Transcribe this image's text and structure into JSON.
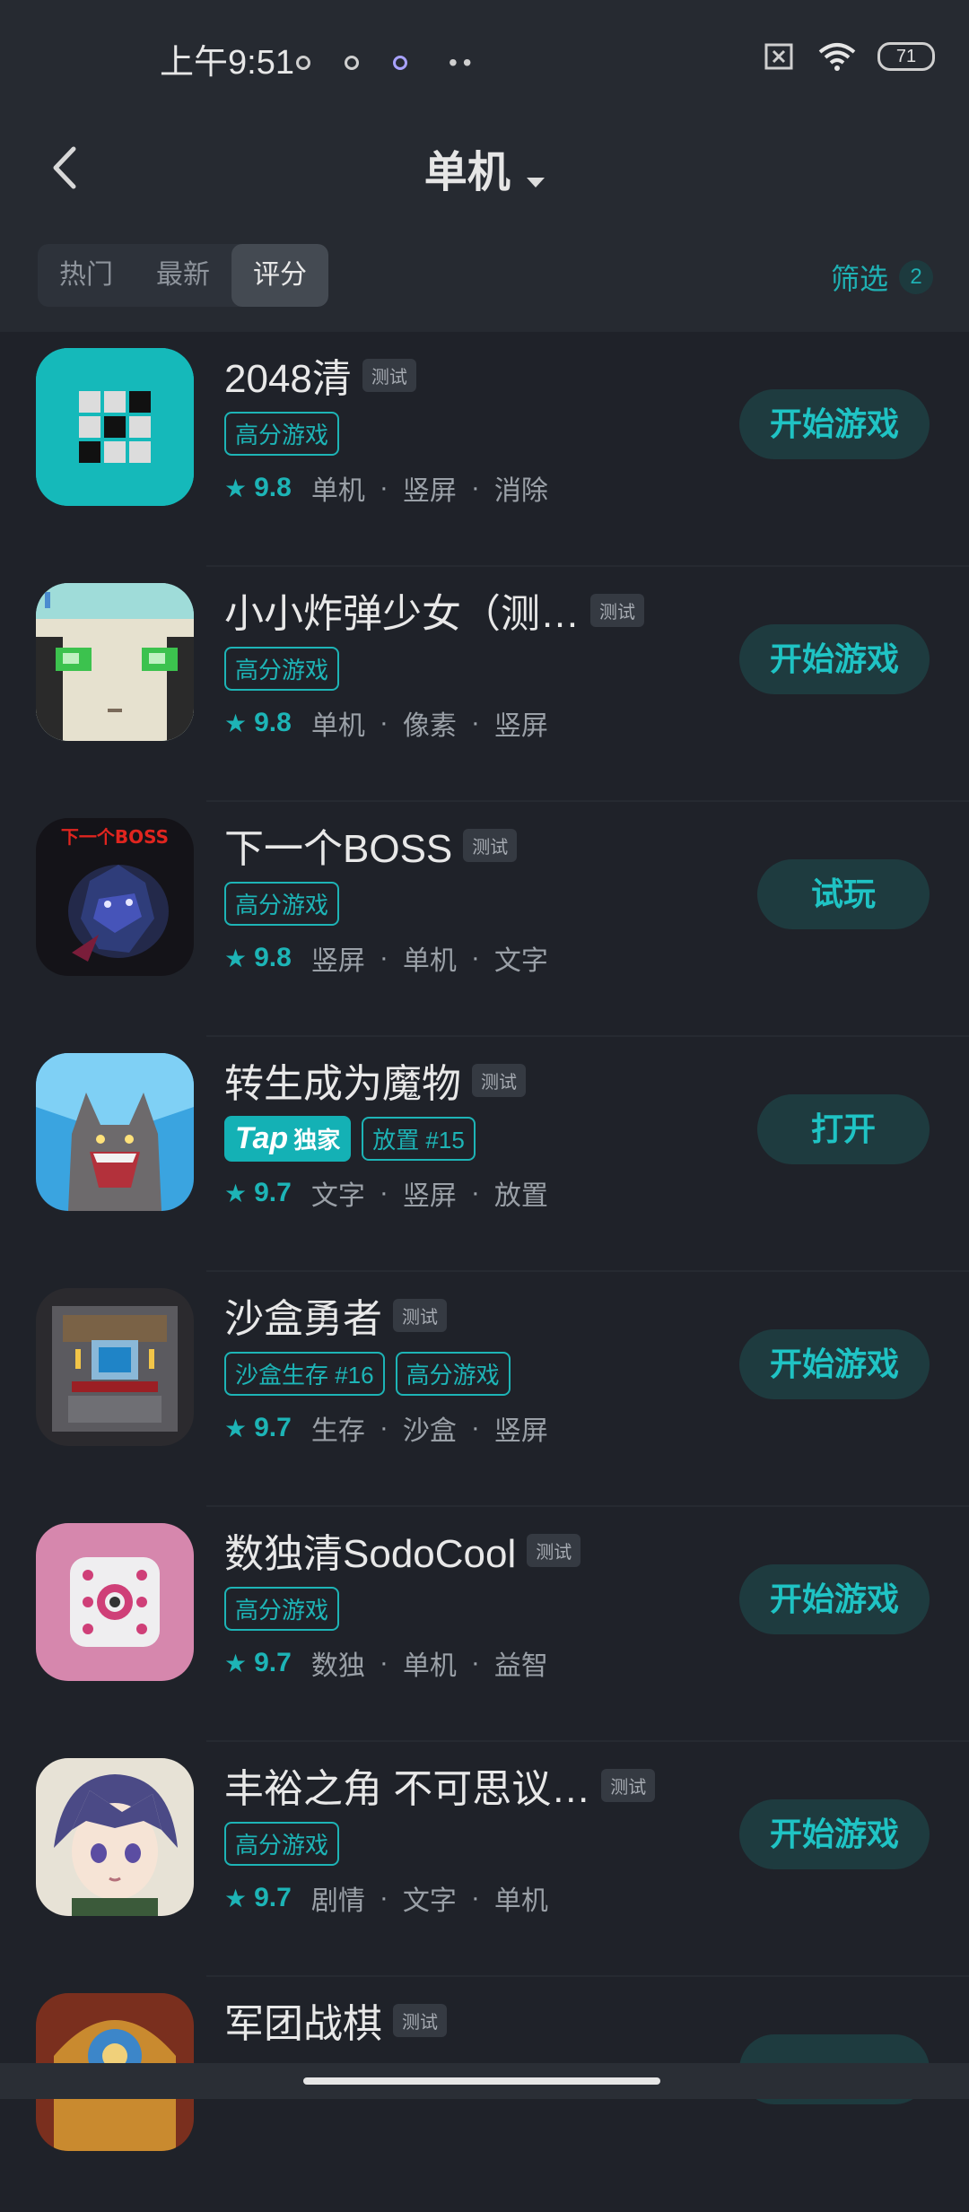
{
  "status_bar": {
    "time": "上午9:51",
    "battery": "71"
  },
  "header": {
    "title": "单机",
    "tabs": [
      "热门",
      "最新",
      "评分"
    ],
    "active_tab": "评分",
    "filter_label": "筛选",
    "filter_count": "2"
  },
  "test_badge": "测试",
  "games": [
    {
      "name": "2048清",
      "tags": [
        {
          "text": "高分游戏"
        }
      ],
      "rating": "9.8",
      "genres": [
        "单机",
        "竖屏",
        "消除"
      ],
      "action": "开始游戏",
      "icon": "grid-puzzle-icon"
    },
    {
      "name": "小小炸弹少女（测…",
      "tags": [
        {
          "text": "高分游戏"
        }
      ],
      "rating": "9.8",
      "genres": [
        "单机",
        "像素",
        "竖屏"
      ],
      "action": "开始游戏",
      "icon": "pixel-girl-icon"
    },
    {
      "name": "下一个BOSS",
      "tags": [
        {
          "text": "高分游戏"
        }
      ],
      "rating": "9.8",
      "genres": [
        "竖屏",
        "单机",
        "文字"
      ],
      "action": "试玩",
      "icon": "boss-dragon-icon",
      "icon_text": "下一个BOSS"
    },
    {
      "name": "转生成为魔物",
      "tags": [
        {
          "text": "独家",
          "tap_prefix": "Tap",
          "style": "tap"
        },
        {
          "text": "放置 #15"
        }
      ],
      "rating": "9.7",
      "genres": [
        "文字",
        "竖屏",
        "放置"
      ],
      "action": "打开",
      "icon": "werewolf-icon"
    },
    {
      "name": "沙盒勇者",
      "tags": [
        {
          "text": "沙盒生存 #16"
        },
        {
          "text": "高分游戏"
        }
      ],
      "rating": "9.7",
      "genres": [
        "生存",
        "沙盒",
        "竖屏"
      ],
      "action": "开始游戏",
      "icon": "pixel-shrine-icon"
    },
    {
      "name": "数独清SodoCool",
      "tags": [
        {
          "text": "高分游戏"
        }
      ],
      "rating": "9.7",
      "genres": [
        "数独",
        "单机",
        "益智"
      ],
      "action": "开始游戏",
      "icon": "sudoku-dice-icon"
    },
    {
      "name": "丰裕之角 不可思议…",
      "tags": [
        {
          "text": "高分游戏"
        }
      ],
      "rating": "9.7",
      "genres": [
        "剧情",
        "文字",
        "单机"
      ],
      "action": "开始游戏",
      "icon": "anime-boy-icon"
    },
    {
      "name": "军团战棋",
      "tags": [],
      "rating": "",
      "genres": [],
      "action": "",
      "icon": "legion-chess-icon"
    }
  ],
  "colors": {
    "accent": "#1db4b6",
    "background": "#1f2229",
    "header": "#262a31",
    "button": "#1e3b3f"
  }
}
